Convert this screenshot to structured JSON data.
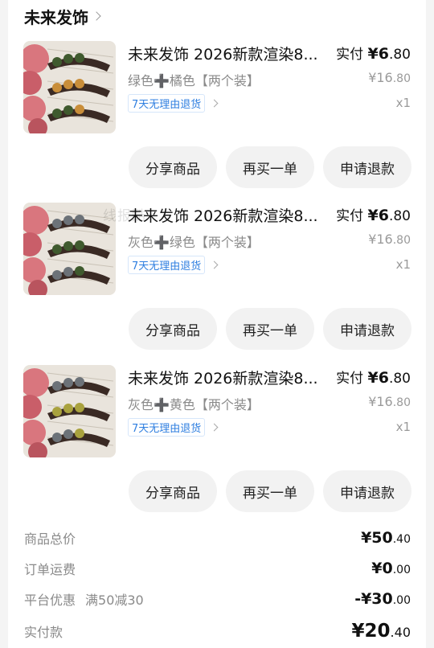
{
  "store": {
    "name": "未来发饰"
  },
  "watermark": "线报酷",
  "items": [
    {
      "title": "未来发饰 2026新款渲染8...",
      "spec": "绿色➕橘色【两个装】",
      "return_tag": "7天无理由退货",
      "paid_label": "实付",
      "paid_int": "¥6",
      "paid_dec": ".80",
      "orig_int": "¥16",
      "orig_dec": ".80",
      "qty": "x1",
      "bead_colors": [
        "#3f5a2e",
        "#c98e3a"
      ],
      "actions": [
        "分享商品",
        "再买一单",
        "申请退款"
      ]
    },
    {
      "title": "未来发饰 2026新款渲染8...",
      "spec": "灰色➕绿色【两个装】",
      "return_tag": "7天无理由退货",
      "paid_label": "实付",
      "paid_int": "¥6",
      "paid_dec": ".80",
      "orig_int": "¥16",
      "orig_dec": ".80",
      "qty": "x1",
      "bead_colors": [
        "#6c7278",
        "#3f5a2e"
      ],
      "actions": [
        "分享商品",
        "再买一单",
        "申请退款"
      ]
    },
    {
      "title": "未来发饰 2026新款渲染8...",
      "spec": "灰色➕黄色【两个装】",
      "return_tag": "7天无理由退货",
      "paid_label": "实付",
      "paid_int": "¥6",
      "paid_dec": ".80",
      "orig_int": "¥16",
      "orig_dec": ".80",
      "qty": "x1",
      "bead_colors": [
        "#6c7278",
        "#a9a23e"
      ],
      "actions": [
        "分享商品",
        "再买一单",
        "申请退款"
      ]
    }
  ],
  "summary": {
    "goods_total_label": "商品总价",
    "goods_total_int": "¥50",
    "goods_total_dec": ".40",
    "shipping_label": "订单运费",
    "shipping_int": "¥0",
    "shipping_dec": ".00",
    "discount_label": "平台优惠",
    "discount_note": "满50减30",
    "discount_int": "-¥30",
    "discount_dec": ".00",
    "paid_label": "实付款",
    "paid_int": "¥20",
    "paid_dec": ".40"
  },
  "colors": {
    "return_tag_text": "#2f7fe0",
    "button_bg": "#f2f2f2",
    "muted_text": "#8a8a8a"
  }
}
